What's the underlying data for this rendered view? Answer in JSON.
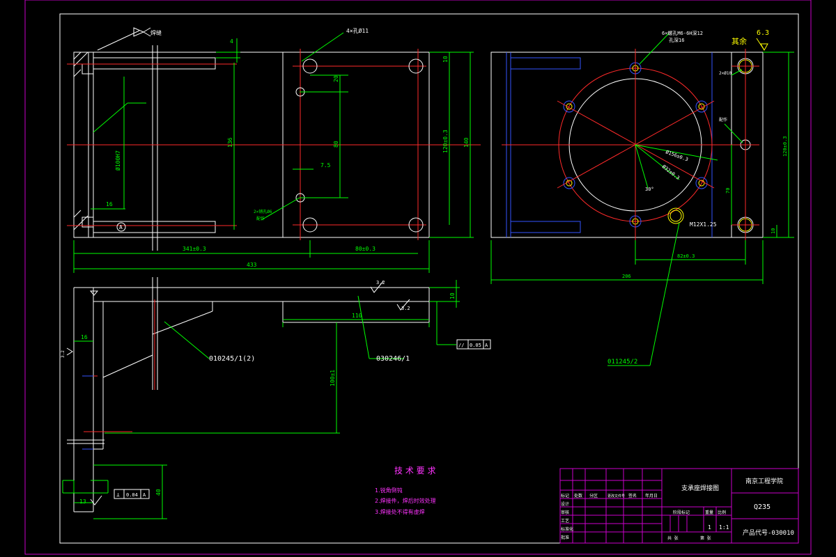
{
  "colors": {
    "background": "#000000",
    "outline": "#ffffff",
    "dimension": "#00ff00",
    "centerline": "#ff2a2a",
    "frame": "#cc00cc",
    "hidden": "#3355ff",
    "note": "#ff33ff",
    "accent": "#ffff00"
  },
  "views": {
    "left": {
      "weld_symbol": "焊缝",
      "hole_callout": "4×孔Ø11",
      "dim_top": "4",
      "dim_bore": "Ø100H7",
      "dim_136": "136",
      "dim_20": "20",
      "dim_80": "80",
      "dim_7_5": "7.5",
      "dim_10": "10",
      "dim_120": "120±0.3",
      "dim_140": "140",
      "dim_16": "16",
      "datum_a": "A",
      "pin_callout": "2×销孔Ø6",
      "pin_callout2": "配作",
      "dim_341": "341±0.3",
      "dim_80b": "80±0.3",
      "dim_433": "433"
    },
    "right": {
      "hole_callout": "6×螺孔M6-6H深12",
      "hole_callout2": "孔深16",
      "rest_label": "其余",
      "roughness": "6.3",
      "dim_phi156": "Ø156±0.3",
      "dim_phi32": "Ø32±0.3",
      "angle_30": "30°",
      "thread": "M12X1.25",
      "pin_label": "2×Ø10",
      "pin_label2": "配作",
      "dim_120": "120±0.3",
      "dim_70": "70",
      "dim_10": "10",
      "dim_82": "82±0.3",
      "dim_206": "206"
    },
    "bottom": {
      "dim_10": "10",
      "dim_110": "110",
      "roughness1": "3.2",
      "roughness2": "3.2",
      "flatness": "0.05",
      "datum": "A",
      "part1": "010245/1(2)",
      "part2": "030246/1",
      "part3": "011245/2",
      "dim_16": "16",
      "dim_100": "100±1",
      "dim_13": "13",
      "dim_40": "40",
      "perp": "⊥",
      "perp_val": "0.04",
      "perp_datum": "A",
      "roughness_side": "3.2"
    }
  },
  "notes": {
    "title": "技 术 要 求",
    "items": [
      "1.锐角倒钝",
      "2.焊接件，焊后时效处理",
      "3.焊接处不得有虚焊"
    ]
  },
  "title_block": {
    "drawing_name": "支承座焊接图",
    "school": "南京工程学院",
    "material": "Q235",
    "scale": "1:1",
    "sheet_count": "1",
    "product_code": "产品代号-030010",
    "row_labels": [
      "设计",
      "审核",
      "工艺",
      "标准化",
      "批准"
    ],
    "col_labels": [
      "标记",
      "处数",
      "分区",
      "更改文件号",
      "签名",
      "年月日"
    ],
    "stage_label": "阶段标记",
    "weight_label": "重量",
    "scale_label": "比例",
    "sheet_label": "共  张",
    "page_label": "第  张"
  }
}
